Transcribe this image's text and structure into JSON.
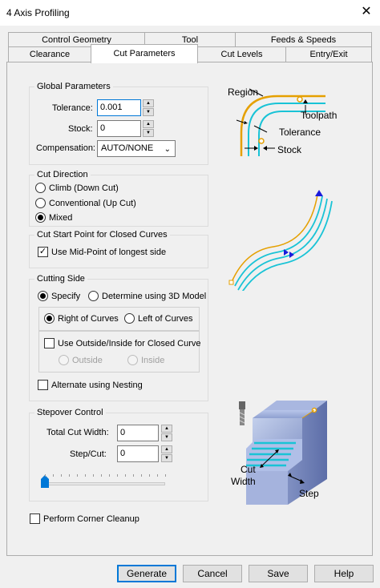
{
  "window": {
    "title": "4 Axis Profiling",
    "close_glyph": "✕"
  },
  "tabs_row1": [
    {
      "label": "Control Geometry"
    },
    {
      "label": "Tool"
    },
    {
      "label": "Feeds & Speeds"
    }
  ],
  "tabs_row2": [
    {
      "label": "Clearance"
    },
    {
      "label": "Cut Parameters",
      "active": true
    },
    {
      "label": "Cut Levels"
    },
    {
      "label": "Entry/Exit"
    }
  ],
  "global_parameters": {
    "title": "Global Parameters",
    "tolerance_label": "Tolerance:",
    "tolerance_value": "0.001",
    "stock_label": "Stock:",
    "stock_value": "0",
    "compensation_label": "Compensation:",
    "compensation_value": "AUTO/NONE"
  },
  "cut_direction": {
    "title": "Cut Direction",
    "options": [
      "Climb (Down Cut)",
      "Conventional (Up Cut)",
      "Mixed"
    ],
    "selected": "Mixed"
  },
  "cut_start": {
    "title": "Cut Start Point for Closed Curves",
    "checkbox_label": "Use Mid-Point of longest side",
    "checked": true
  },
  "cutting_side": {
    "title": "Cutting Side",
    "specify_label": "Specify",
    "determine_label": "Determine using 3D Model",
    "selected": "Specify",
    "right_label": "Right of Curves",
    "left_label": "Left of Curves",
    "side_selected": "Right of Curves",
    "use_outside_inside_label": "Use Outside/Inside for Closed Curve",
    "outside_label": "Outside",
    "inside_label": "Inside",
    "alternate_label": "Alternate using Nesting"
  },
  "stepover": {
    "title": "Stepover Control",
    "total_cut_width_label": "Total Cut Width:",
    "total_cut_width_value": "0",
    "step_cut_label": "Step/Cut:",
    "step_cut_value": "0",
    "slider_value": 0
  },
  "corner_cleanup_label": "Perform Corner Cleanup",
  "diagram_labels": {
    "region": "Region",
    "toolpath": "Toolpath",
    "tolerance": "Tolerance",
    "stock": "Stock",
    "cut_width_1": "Cut",
    "cut_width_2": "Width",
    "step": "Step"
  },
  "buttons": {
    "generate": "Generate",
    "cancel": "Cancel",
    "save": "Save",
    "help": "Help"
  },
  "colors": {
    "accent": "#0078d7",
    "region_curve": "#e5a000",
    "toolpath_curve": "#19c3d6",
    "arrow_blue": "#1a1adb"
  }
}
